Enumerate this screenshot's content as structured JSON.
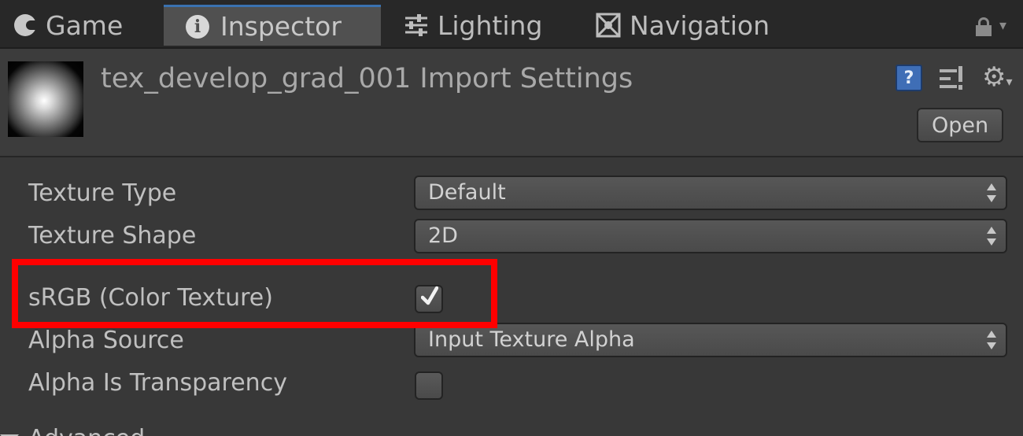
{
  "tabs": [
    {
      "label": "Game",
      "icon": "pacman-icon"
    },
    {
      "label": "Inspector",
      "icon": "info-icon",
      "active": true
    },
    {
      "label": "Lighting",
      "icon": "sliders-icon"
    },
    {
      "label": "Navigation",
      "icon": "navigation-icon"
    }
  ],
  "header": {
    "title": "tex_develop_grad_001 Import Settings",
    "open_label": "Open",
    "help_symbol": "?"
  },
  "settings": {
    "texture_type": {
      "label": "Texture Type",
      "value": "Default"
    },
    "texture_shape": {
      "label": "Texture Shape",
      "value": "2D"
    },
    "srgb": {
      "label": "sRGB (Color Texture)",
      "checked": true
    },
    "alpha_source": {
      "label": "Alpha Source",
      "value": "Input Texture Alpha"
    },
    "alpha_transparency": {
      "label": "Alpha Is Transparency",
      "checked": false
    }
  },
  "advanced": {
    "label": "Advanced"
  },
  "colors": {
    "highlight": "#ff0000",
    "accent": "#3a72b0",
    "panel_bg": "#383838"
  }
}
